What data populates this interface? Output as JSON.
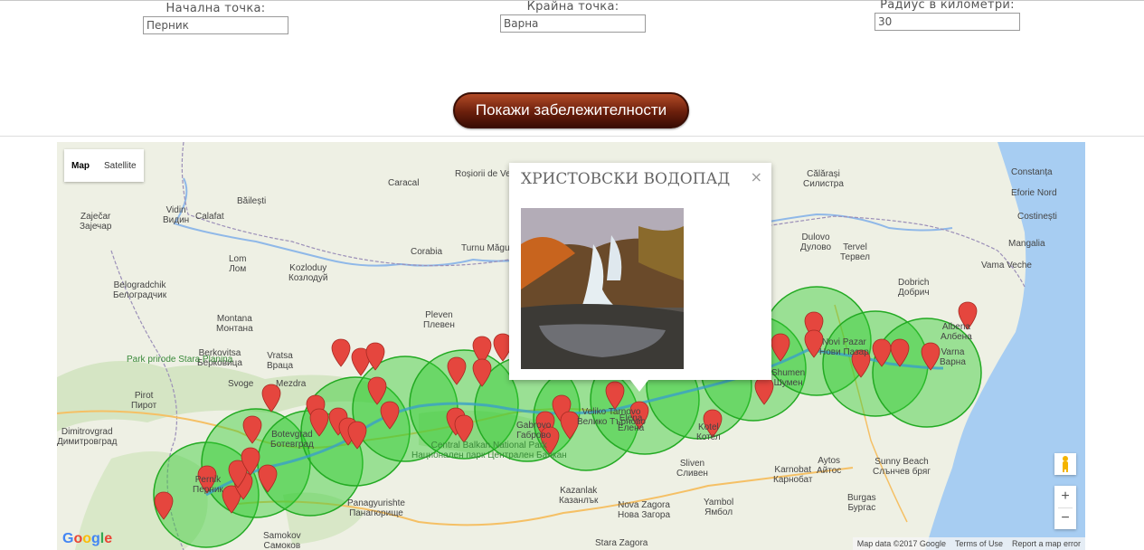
{
  "form": {
    "start": {
      "label": "Начална точка:",
      "value": "Перник"
    },
    "end": {
      "label": "Крайна точка:",
      "value": "Варна"
    },
    "radius": {
      "label": "Радиус в километри:",
      "value": "30"
    },
    "submit_label": "Покажи забележителности"
  },
  "map": {
    "type_map": "Map",
    "type_satellite": "Satellite",
    "zoom_in": "+",
    "zoom_out": "−",
    "footer": {
      "data": "Map data ©2017 Google",
      "terms": "Terms of Use",
      "report": "Report a map error"
    },
    "google_logo": "Google",
    "info_window": {
      "title": "ХРИСТОВСКИ ВОДОПАД",
      "close": "×"
    },
    "places": [
      {
        "name": "Călărași",
        "sub": "Силистра"
      },
      {
        "name": "Constanța"
      },
      {
        "name": "Eforie Nord"
      },
      {
        "name": "Costinești"
      },
      {
        "name": "Mangalia"
      },
      {
        "name": "Dobrich",
        "sub": "Добрич"
      },
      {
        "name": "Varna",
        "sub": "Варна"
      },
      {
        "name": "Albena",
        "sub": "Албена"
      },
      {
        "name": "Vama Veche"
      },
      {
        "name": "Caracal"
      },
      {
        "name": "Băilești"
      },
      {
        "name": "Calafat"
      },
      {
        "name": "Vidin",
        "sub": "Видин"
      },
      {
        "name": "Zaječar",
        "sub": "Зајечар"
      },
      {
        "name": "Lom",
        "sub": "Лом"
      },
      {
        "name": "Kozloduy",
        "sub": "Козлодуй"
      },
      {
        "name": "Corabia"
      },
      {
        "name": "Turnu Măgurele"
      },
      {
        "name": "Roșiorii de Vede"
      },
      {
        "name": "Belogradchik",
        "sub": "Белоградчик"
      },
      {
        "name": "Montana",
        "sub": "Монтана"
      },
      {
        "name": "Berkovitsa",
        "sub": "Берковица"
      },
      {
        "name": "Vratsa",
        "sub": "Враца"
      },
      {
        "name": "Pleven",
        "sub": "Плевен"
      },
      {
        "name": "Park prirode Stara Planina"
      },
      {
        "name": "Pirot",
        "sub": "Пирот"
      },
      {
        "name": "Dimitrovgrad",
        "sub": "Димитровград"
      },
      {
        "name": "Svoge"
      },
      {
        "name": "Mezdra"
      },
      {
        "name": "Botevgrad",
        "sub": "Ботевград"
      },
      {
        "name": "Pernik",
        "sub": "Перник"
      },
      {
        "name": "Samokov",
        "sub": "Самоков"
      },
      {
        "name": "Panagyurishte",
        "sub": "Панагюрище"
      },
      {
        "name": "Central Balkan National Park",
        "sub": "Национален парк Централен Балкан"
      },
      {
        "name": "Gabrovo",
        "sub": "Габрово"
      },
      {
        "name": "Veliko Tarnovo",
        "sub": "Велико Търново"
      },
      {
        "name": "Elena",
        "sub": "Елена"
      },
      {
        "name": "Kazanlak",
        "sub": "Казанлък"
      },
      {
        "name": "Sliven",
        "sub": "Сливен"
      },
      {
        "name": "Nova Zagora",
        "sub": "Нова Загора"
      },
      {
        "name": "Yambol",
        "sub": "Ямбол"
      },
      {
        "name": "Stara Zagora"
      },
      {
        "name": "Kotel",
        "sub": "Котел"
      },
      {
        "name": "Shumen",
        "sub": "Шумен"
      },
      {
        "name": "Novi Pazar",
        "sub": "Нови Пазар"
      },
      {
        "name": "Karnobat",
        "sub": "Карнобат"
      },
      {
        "name": "Aytos",
        "sub": "Айтос"
      },
      {
        "name": "Sunny Beach",
        "sub": "Слънчев бряг"
      },
      {
        "name": "Burgas",
        "sub": "Бургас"
      },
      {
        "name": "Dulovo",
        "sub": "Дулово"
      },
      {
        "name": "Tervel",
        "sub": "Тервел"
      },
      {
        "name": "Dimitrovgrad"
      }
    ]
  }
}
